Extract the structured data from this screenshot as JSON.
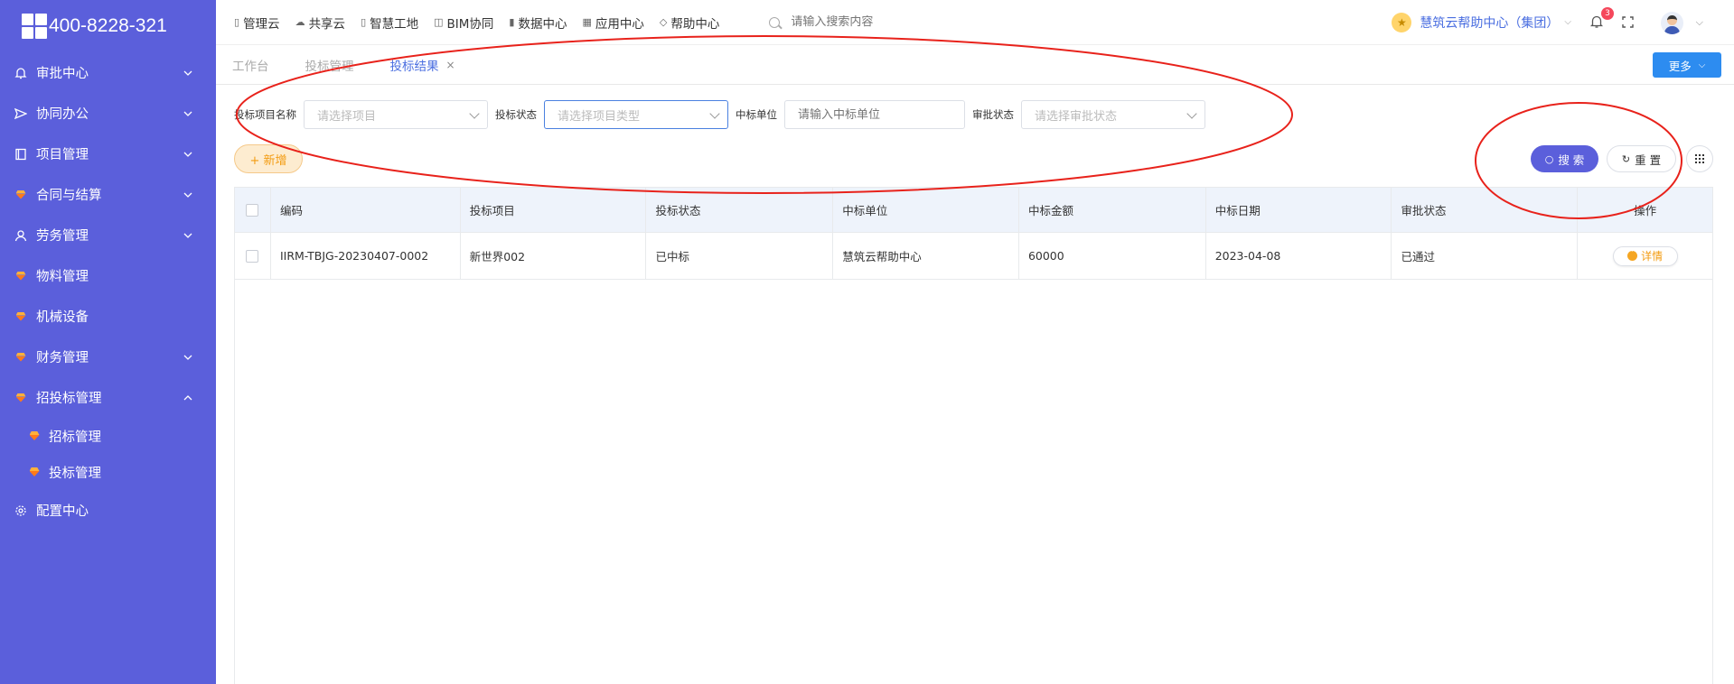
{
  "sidebar": {
    "phone": "400-8228-321",
    "items": [
      {
        "label": "审批中心",
        "icon": "bell-icon",
        "expanded": false
      },
      {
        "label": "协同办公",
        "icon": "send-icon",
        "expanded": false
      },
      {
        "label": "项目管理",
        "icon": "book-icon",
        "expanded": false
      },
      {
        "label": "合同与结算",
        "icon": "gem-icon",
        "expanded": false
      },
      {
        "label": "劳务管理",
        "icon": "worker-icon",
        "expanded": false
      },
      {
        "label": "物料管理",
        "icon": "gem-icon"
      },
      {
        "label": "机械设备",
        "icon": "gem-icon"
      },
      {
        "label": "财务管理",
        "icon": "gem-icon",
        "expanded": false
      },
      {
        "label": "招投标管理",
        "icon": "gem-icon",
        "expanded": true
      }
    ],
    "sub_items": [
      {
        "label": "招标管理"
      },
      {
        "label": "投标管理"
      }
    ],
    "config": {
      "label": "配置中心",
      "icon": "gear-icon"
    }
  },
  "topbar": {
    "nav": [
      {
        "label": "管理云",
        "icon": "doc-icon"
      },
      {
        "label": "共享云",
        "icon": "cloud-icon"
      },
      {
        "label": "智慧工地",
        "icon": "book-icon"
      },
      {
        "label": "BIM协同",
        "icon": "cube-icon"
      },
      {
        "label": "数据中心",
        "icon": "bar-chart-icon"
      },
      {
        "label": "应用中心",
        "icon": "grid-icon"
      },
      {
        "label": "帮助中心",
        "icon": "tag-icon"
      }
    ],
    "search_placeholder": "请输入搜索内容",
    "org_name": "慧筑云帮助中心（集团）",
    "notification_count": "3"
  },
  "tabs": {
    "items": [
      {
        "label": "工作台",
        "active": false
      },
      {
        "label": "投标管理",
        "active": false
      },
      {
        "label": "投标结果",
        "active": true
      }
    ],
    "more_label": "更多"
  },
  "filters": {
    "project_name_label": "投标项目名称",
    "project_name_placeholder": "请选择项目",
    "bid_status_label": "投标状态",
    "bid_status_placeholder": "请选择项目类型",
    "winner_label": "中标单位",
    "winner_placeholder": "请输入中标单位",
    "approval_label": "审批状态",
    "approval_placeholder": "请选择审批状态"
  },
  "actions": {
    "add_label": "+ 新增",
    "search_label": "搜 索",
    "reset_label": "重 置"
  },
  "table": {
    "headers": [
      "编码",
      "投标项目",
      "投标状态",
      "中标单位",
      "中标金额",
      "中标日期",
      "审批状态",
      "操作"
    ],
    "rows": [
      {
        "code": "IIRM-TBJG-20230407-0002",
        "project": "新世界002",
        "status": "已中标",
        "winner": "慧筑云帮助中心",
        "amount": "60000",
        "date": "2023-04-08",
        "approval": "已通过",
        "action": "详情"
      }
    ]
  },
  "colors": {
    "sidebar_bg": "#5b5fdb",
    "primary": "#5b5fdb",
    "link": "#4a6ee0",
    "more_btn": "#2d8cf0",
    "add_btn": "#f39c12",
    "annotation": "#e8221b"
  }
}
